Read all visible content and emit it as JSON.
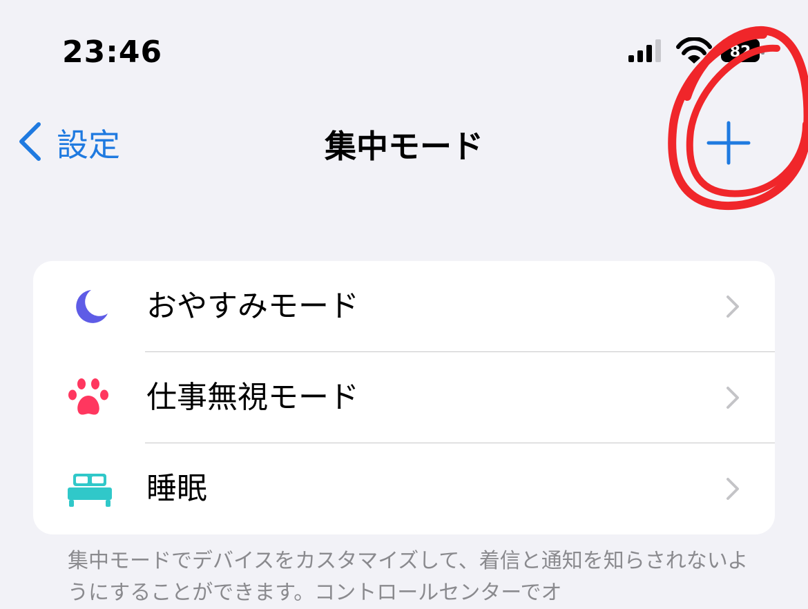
{
  "status": {
    "time": "23:46",
    "battery": "82"
  },
  "nav": {
    "back_label": "設定",
    "title": "集中モード"
  },
  "focus_modes": [
    {
      "label": "おやすみモード",
      "icon": "moon-icon",
      "color": "#5e5ce6"
    },
    {
      "label": "仕事無視モード",
      "icon": "paw-icon",
      "color": "#ff375f"
    },
    {
      "label": "睡眠",
      "icon": "bed-icon",
      "color": "#30c8c9"
    }
  ],
  "footer": {
    "text": "集中モードでデバイスをカスタマイズして、着信と通知を知らされないようにすることができます。コントロールセンターでオ"
  },
  "colors": {
    "accent": "#1f7ae0",
    "background": "#f2f2f7",
    "annotation": "#f0262a"
  }
}
